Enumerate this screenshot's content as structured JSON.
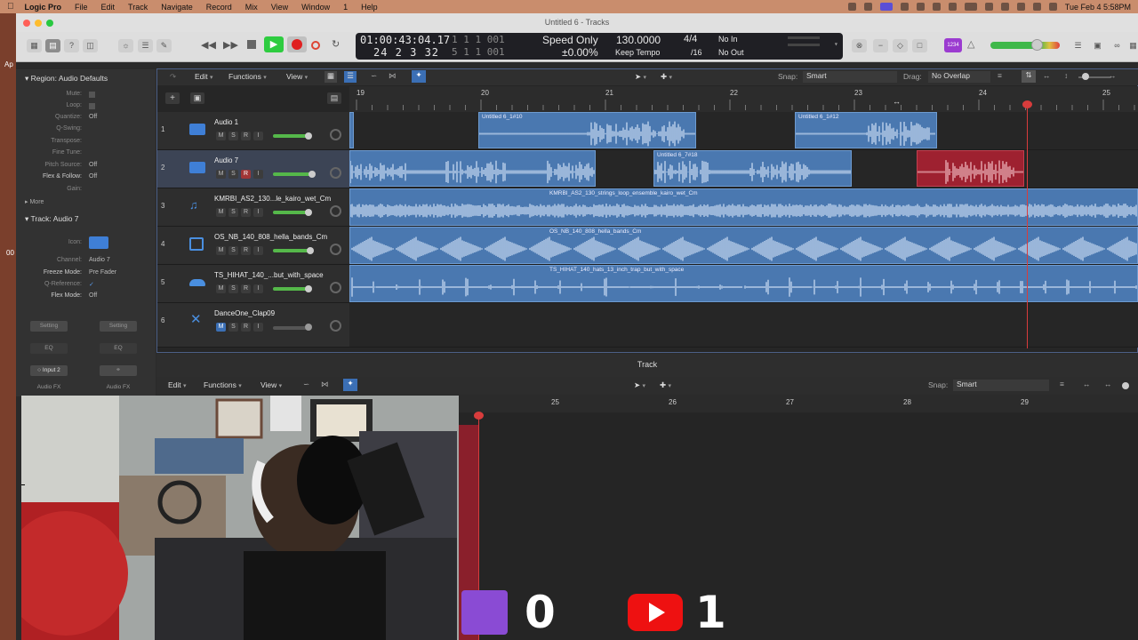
{
  "menubar": {
    "app": "Logic Pro",
    "items": [
      "File",
      "Edit",
      "Track",
      "Navigate",
      "Record",
      "Mix",
      "View",
      "Window",
      "1",
      "Help"
    ],
    "clock": "Tue Feb 4  5:58PM"
  },
  "window": {
    "title": "Untitled 6 - Tracks"
  },
  "lcd": {
    "smpte": "01:00:43:04.17",
    "bars_top": "1  1  1  001",
    "position": "24  2  3  32",
    "bars_bottom": "5  1  1  001",
    "mode": "Speed Only",
    "percent": "±0.00%",
    "tempo": "130.0000",
    "keep": "Keep Tempo",
    "sig_top": "4/4",
    "sig_bottom": "/16",
    "in": "No In",
    "out": "No Out"
  },
  "toolbar": {
    "badge": "1234"
  },
  "inspector": {
    "region_header": "Region: Audio Defaults",
    "rows": [
      {
        "label": "Mute:",
        "value": ""
      },
      {
        "label": "Loop:",
        "value": ""
      },
      {
        "label": "Quantize:",
        "value": "Off"
      },
      {
        "label": "Q-Swing:",
        "value": ""
      },
      {
        "label": "Transpose:",
        "value": ""
      },
      {
        "label": "Fine Tune:",
        "value": ""
      },
      {
        "label": "Pitch Source:",
        "value": "Off"
      },
      {
        "label": "Flex & Follow:",
        "value": "Off"
      },
      {
        "label": "Gain:",
        "value": ""
      }
    ],
    "more": "More",
    "track_header": "Track: Audio 7",
    "track_rows": [
      {
        "label": "Icon:",
        "value": ""
      },
      {
        "label": "Channel:",
        "value": "Audio 7"
      },
      {
        "label": "Freeze Mode:",
        "value": "Pre Fader"
      },
      {
        "label": "Q-Reference:",
        "value": "✓"
      },
      {
        "label": "Flex Mode:",
        "value": "Off"
      }
    ],
    "strip": {
      "setting": "Setting",
      "eq": "EQ",
      "input": "Input 2",
      "audio_fx": "Audio FX"
    }
  },
  "arrange": {
    "menus": {
      "edit": "Edit",
      "functions": "Functions",
      "view": "View"
    },
    "snap_label": "Snap:",
    "snap_value": "Smart",
    "drag_label": "Drag:",
    "drag_value": "No Overlap",
    "ruler": [
      "19",
      "20",
      "21",
      "22",
      "23",
      "24",
      "25"
    ],
    "tracks": [
      {
        "num": "1",
        "name": "Audio 1",
        "rec": false,
        "fader": 0.7
      },
      {
        "num": "2",
        "name": "Audio 7",
        "rec": true,
        "fader": 0.8
      },
      {
        "num": "3",
        "name": "KMRBI_AS2_130...le_kairo_wet_Cm",
        "rec": false,
        "fader": 0.7
      },
      {
        "num": "4",
        "name": "OS_NB_140_808_hella_bands_Cm",
        "rec": false,
        "fader": 0.7
      },
      {
        "num": "5",
        "name": "TS_HIHAT_140_...but_with_space",
        "rec": false,
        "fader": 0.7
      },
      {
        "num": "6",
        "name": "DanceOne_Clap09",
        "rec": false,
        "fader": 0.0
      }
    ],
    "regions": {
      "r10": "Untitled 6_1#10",
      "r12": "Untitled 6_1#12",
      "r18": "Untitled 6_7#18",
      "strings": "KMRBI_AS2_130_strings_loop_ensemble_kairo_wet_Cm",
      "bands": "OS_NB_140_808_hella_bands_Cm",
      "hats": "TS_HIHAT_140_hats_13_inch_trap_but_with_space"
    }
  },
  "editor": {
    "title": "Track",
    "menus": {
      "edit": "Edit",
      "functions": "Functions",
      "view": "View"
    },
    "snap_label": "Snap:",
    "snap_value": "Smart",
    "ruler": [
      "25",
      "26",
      "27",
      "28",
      "29"
    ]
  },
  "overlay": {
    "twitch_count": "0",
    "youtube_count": "1",
    "desktop_label_ap": "Ap",
    "desktop_label_00": "00"
  },
  "colors": {
    "region_blue": "#4a78b0",
    "region_red": "#9e2130",
    "playhead": "#d83c3c",
    "record": "#e02020",
    "play": "#2ecc40"
  }
}
